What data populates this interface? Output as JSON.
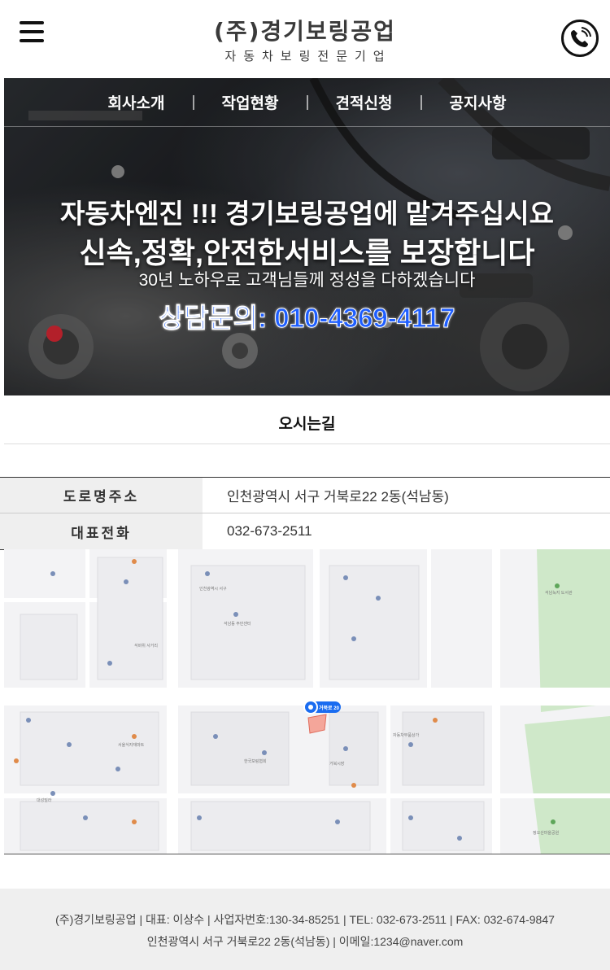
{
  "header": {
    "logo_title": "(주)경기보링공업",
    "logo_subtitle": "자동차보링전문기업"
  },
  "nav": {
    "items": [
      {
        "label": "회사소개"
      },
      {
        "label": "작업현황"
      },
      {
        "label": "견적신청"
      },
      {
        "label": "공지사항"
      }
    ]
  },
  "hero": {
    "line1": "자동차엔진 !!! 경기보링공업에 맡겨주십시요",
    "line2": "신속,정확,안전한서비스를 보장합니다",
    "line3": "30년 노하우로 고객님들께 정성을 다하겠습니다",
    "line4": "상담문의: 010-4369-4117"
  },
  "location": {
    "title": "오시는길",
    "rows": [
      {
        "label": "도로명주소",
        "value": "인천광역시 서구 거북로22 2동(석남동)"
      },
      {
        "label": "대표전화",
        "value": "032-673-2511"
      }
    ]
  },
  "map": {
    "marker_label": "거북로 20",
    "place_labels": [
      "석남녹지 도서관",
      "정오산마을공원",
      "인천광역시 서구",
      "석남동 주민센터",
      "서울식자재마트",
      "거북시장",
      "석바위 사거리",
      "한국보링협회",
      "대성빌라",
      "자동차부품상가"
    ]
  },
  "footer": {
    "line1": "(주)경기보링공업 | 대표: 이상수 | 사업자번호:130-34-85251 | TEL: 032-673-2511 | FAX: 032-674-9847",
    "line2": "인천광역시 서구 거북로22 2동(석남동) | 이메일:1234@naver.com"
  },
  "colors": {
    "accent_blue": "#1e5eff",
    "park_green": "#cfe8c9",
    "marker_blue": "#1a6cf0"
  }
}
